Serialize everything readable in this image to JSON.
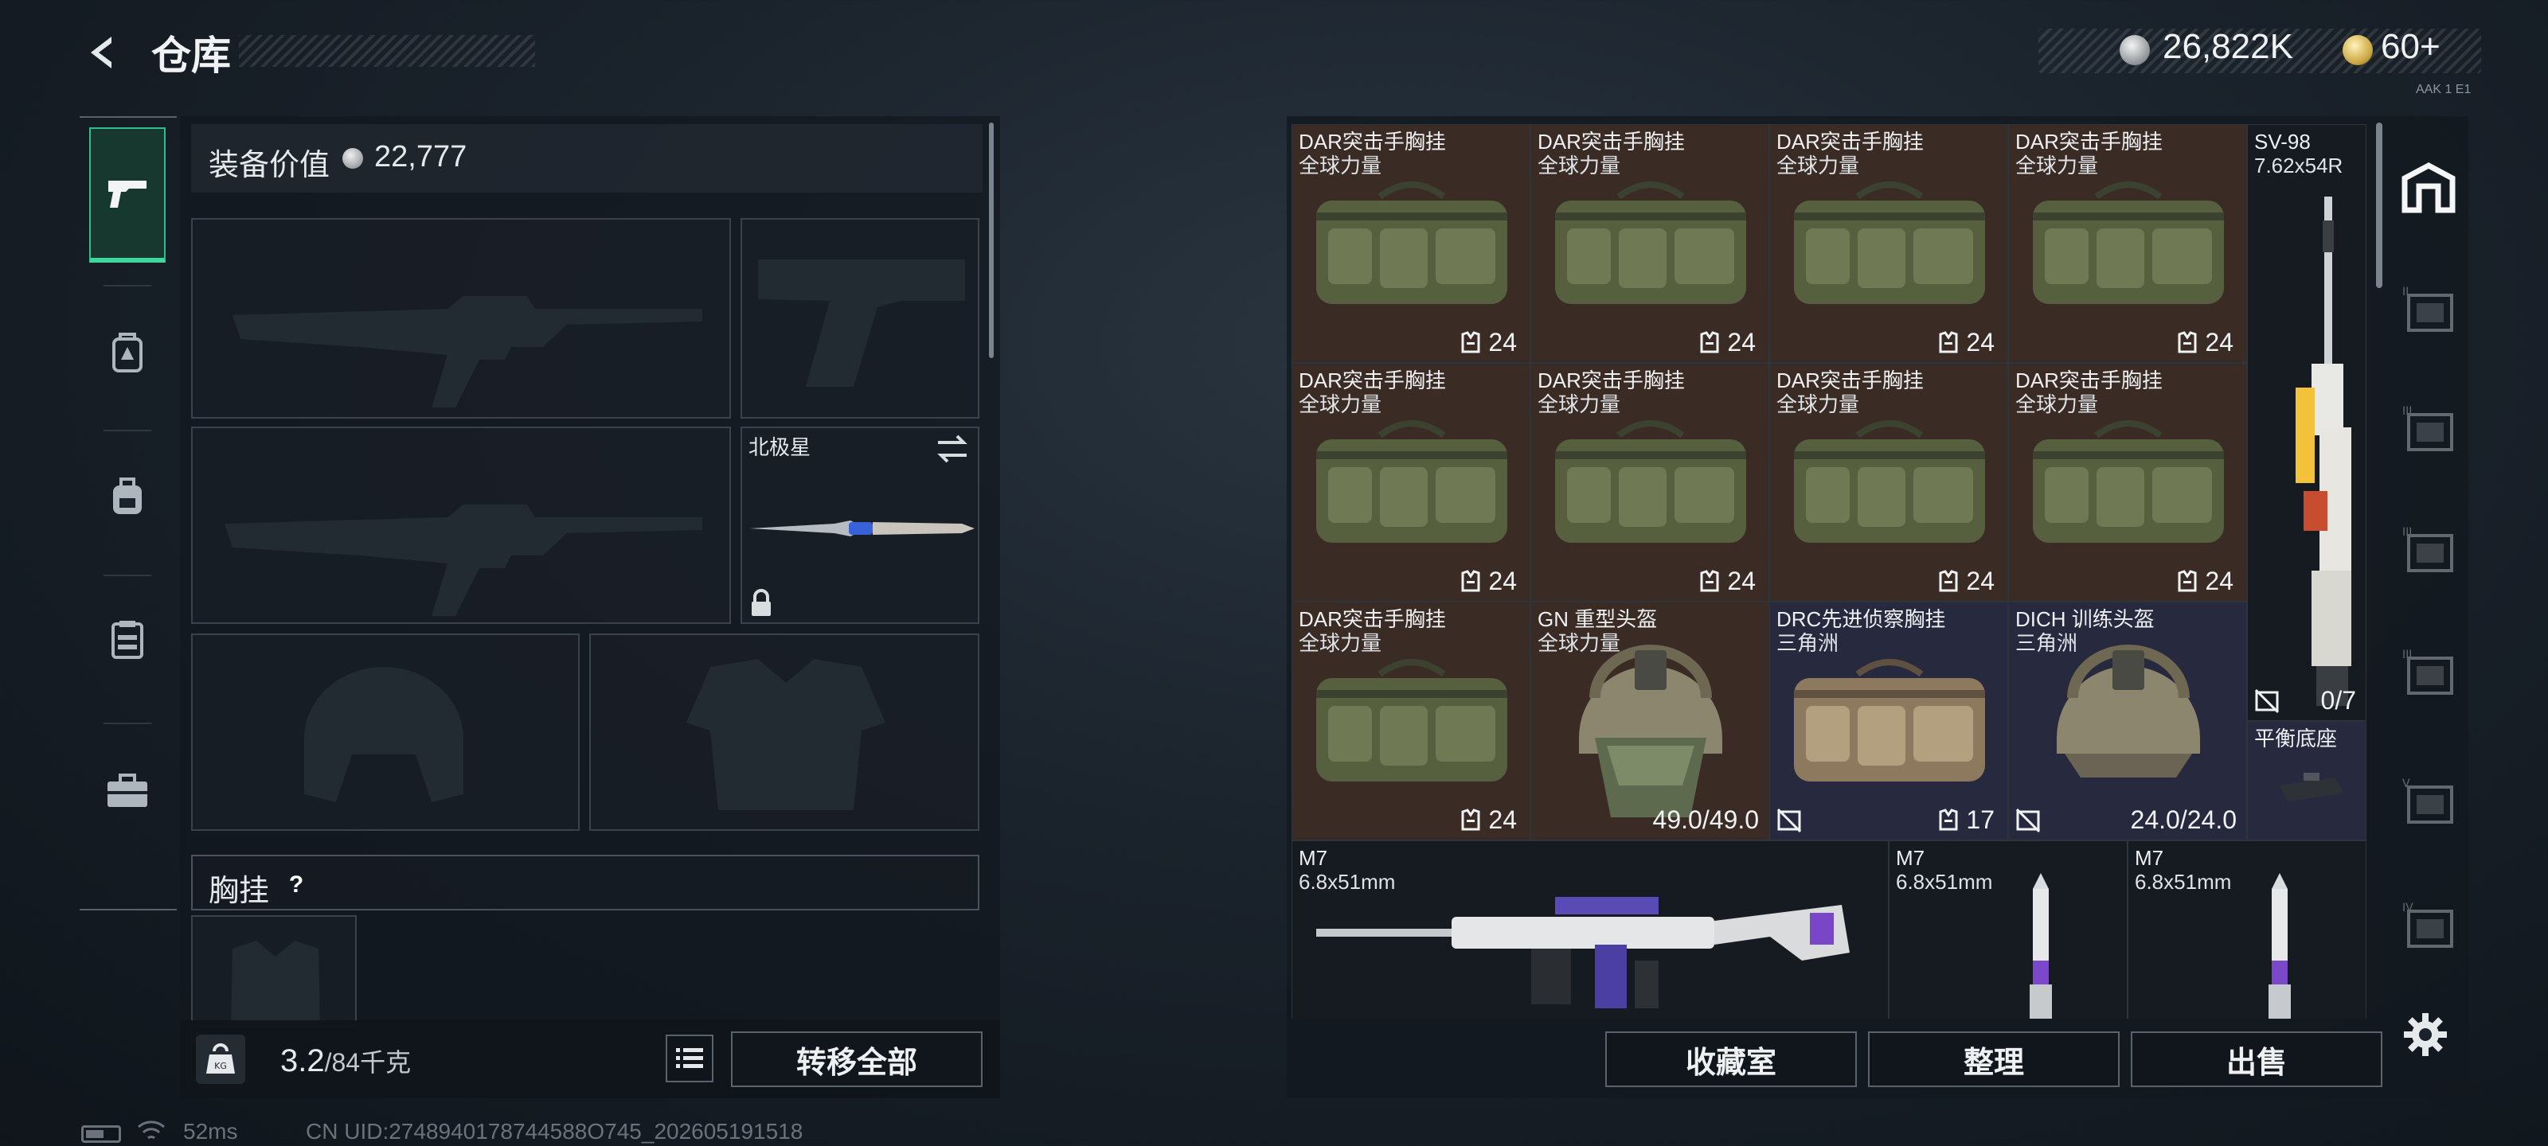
{
  "header": {
    "title": "仓库",
    "money": "26,822K",
    "tickets": "60+",
    "small_tag": "AAK 1 E1"
  },
  "left_nav": {
    "items": [
      {
        "name": "weapons",
        "icon": "pistol-icon",
        "active": true
      },
      {
        "name": "helmet",
        "icon": "helmet-icon"
      },
      {
        "name": "backpack",
        "icon": "backpack-icon"
      },
      {
        "name": "vest",
        "icon": "vest-icon"
      },
      {
        "name": "toolbox",
        "icon": "toolbox-icon"
      }
    ]
  },
  "loadout": {
    "value_label": "装备价值",
    "value": "22,777",
    "melee_name": "北极星",
    "vest_label": "胸挂",
    "vest_help": "?",
    "weight_current": "3.2",
    "weight_max": "/84千克",
    "transfer_label": "转移全部"
  },
  "status": {
    "ping": "52ms",
    "uid": "CN UID:2748940178744588O745_202605191518"
  },
  "stash": {
    "items": [
      {
        "id": "dar1",
        "name": "DAR突击手胸挂",
        "sub": "全球力量",
        "count": "24",
        "bg": "brown",
        "kind": "bag"
      },
      {
        "id": "dar2",
        "name": "DAR突击手胸挂",
        "sub": "全球力量",
        "count": "24",
        "bg": "brown",
        "kind": "bag"
      },
      {
        "id": "dar3",
        "name": "DAR突击手胸挂",
        "sub": "全球力量",
        "count": "24",
        "bg": "brown",
        "kind": "bag"
      },
      {
        "id": "dar4",
        "name": "DAR突击手胸挂",
        "sub": "全球力量",
        "count": "24",
        "bg": "brown",
        "kind": "bag"
      },
      {
        "id": "dar5",
        "name": "DAR突击手胸挂",
        "sub": "全球力量",
        "count": "24",
        "bg": "brown",
        "kind": "bag"
      },
      {
        "id": "dar6",
        "name": "DAR突击手胸挂",
        "sub": "全球力量",
        "count": "24",
        "bg": "brown",
        "kind": "bag"
      },
      {
        "id": "dar7",
        "name": "DAR突击手胸挂",
        "sub": "全球力量",
        "count": "24",
        "bg": "brown",
        "kind": "bag"
      },
      {
        "id": "dar8",
        "name": "DAR突击手胸挂",
        "sub": "全球力量",
        "count": "24",
        "bg": "brown",
        "kind": "bag"
      },
      {
        "id": "dar9",
        "name": "DAR突击手胸挂",
        "sub": "全球力量",
        "count": "24",
        "bg": "brown",
        "kind": "bag"
      },
      {
        "id": "gn",
        "name": "GN 重型头盔",
        "sub": "全球力量",
        "durability": "49.0/49.0",
        "bg": "brown",
        "kind": "helmet-heavy"
      },
      {
        "id": "drc",
        "name": "DRC先进侦察胸挂",
        "sub": "三角洲",
        "count": "17",
        "bg": "blue",
        "kind": "bag-tan"
      },
      {
        "id": "dich",
        "name": "DICH 训练头盔",
        "sub": "三角洲",
        "durability": "24.0/24.0",
        "bg": "blue",
        "kind": "helmet"
      },
      {
        "id": "sv98",
        "name": "SV-98",
        "sub": "7.62x54R",
        "ammo": "0/7",
        "bg": "dark",
        "kind": "sniper"
      },
      {
        "id": "base",
        "name": "平衡底座",
        "bg": "blue",
        "kind": "attachment"
      },
      {
        "id": "m7a",
        "name": "M7",
        "sub": "6.8x51mm",
        "bg": "dark",
        "kind": "rifle"
      },
      {
        "id": "m7b",
        "name": "M7",
        "sub": "6.8x51mm",
        "bg": "dark",
        "kind": "ammo"
      },
      {
        "id": "m7c",
        "name": "M7",
        "sub": "6.8x51mm",
        "bg": "dark",
        "kind": "ammo"
      }
    ]
  },
  "right_nav": [
    {
      "name": "stash-main",
      "icon": "stash-icon",
      "active": true
    },
    {
      "name": "stash-2",
      "icon": "stash-page-icon",
      "label": "II"
    },
    {
      "name": "stash-3",
      "icon": "stash-page-icon",
      "label": "III"
    },
    {
      "name": "stash-4",
      "icon": "stash-page-icon",
      "label": "III"
    },
    {
      "name": "stash-5",
      "icon": "stash-page-icon",
      "label": "III"
    },
    {
      "name": "stash-6",
      "icon": "stash-page-icon",
      "label": "V"
    },
    {
      "name": "stash-7",
      "icon": "stash-page-icon",
      "label": "IV"
    }
  ],
  "actions": {
    "collection": "收藏室",
    "organize": "整理",
    "sell": "出售"
  },
  "colors": {
    "accent": "#3fd79b",
    "rare_bg": "#27293f",
    "common_bg": "#3a2c25"
  }
}
